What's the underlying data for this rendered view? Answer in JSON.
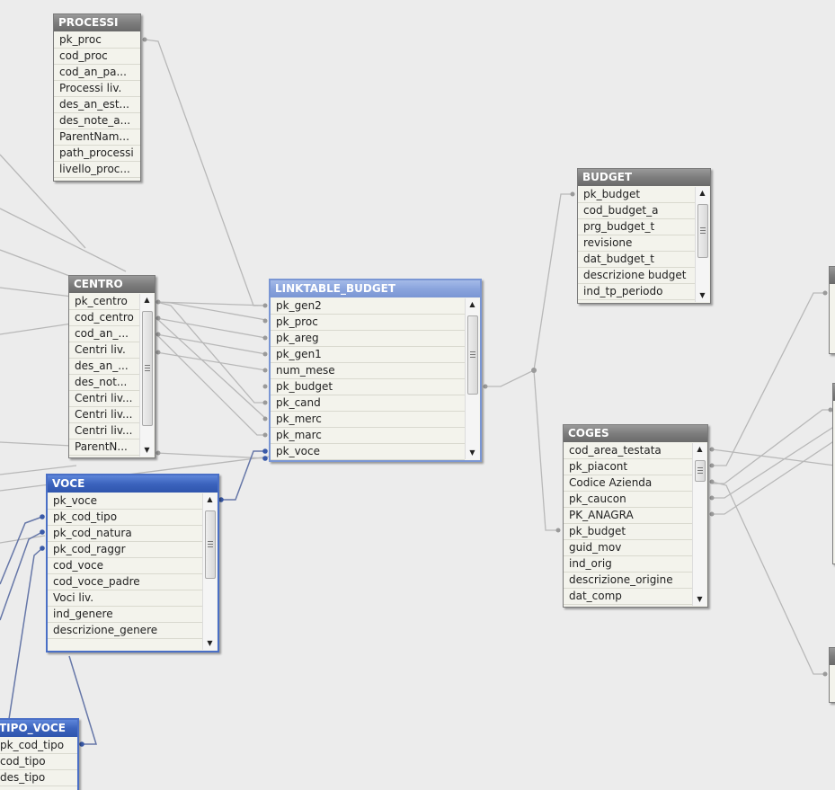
{
  "tables": {
    "processi": {
      "title": "PROCESSI",
      "fields": [
        "pk_proc",
        "cod_proc",
        "cod_an_pa...",
        "Processi liv.",
        "des_an_est...",
        "des_note_a...",
        "ParentNam...",
        "path_processi",
        "livello_proc..."
      ]
    },
    "centro": {
      "title": "CENTRO",
      "fields": [
        "pk_centro",
        "cod_centro",
        "cod_an_...",
        "Centri liv.",
        "des_an_...",
        "des_not...",
        "Centri liv...",
        "Centri liv...",
        "Centri liv...",
        "ParentN..."
      ]
    },
    "linktable": {
      "title": "LINKTABLE_BUDGET",
      "fields": [
        "pk_gen2",
        "pk_proc",
        "pk_areg",
        "pk_gen1",
        "num_mese",
        "pk_budget",
        "pk_cand",
        "pk_merc",
        "pk_marc",
        "pk_voce"
      ]
    },
    "budget": {
      "title": "BUDGET",
      "fields": [
        "pk_budget",
        "cod_budget_a",
        "prg_budget_t",
        "revisione",
        "dat_budget_t",
        "descrizione budget",
        "ind_tp_periodo"
      ]
    },
    "coges": {
      "title": "COGES",
      "fields": [
        "cod_area_testata",
        "pk_piacont",
        "Codice Azienda",
        "pk_caucon",
        "PK_ANAGRA",
        "pk_budget",
        "guid_mov",
        "ind_orig",
        "descrizione_origine",
        "dat_comp"
      ]
    },
    "voce": {
      "title": "VOCE",
      "fields": [
        "pk_voce",
        "pk_cod_tipo",
        "pk_cod_natura",
        "pk_cod_raggr",
        "cod_voce",
        "cod_voce_padre",
        "Voci liv.",
        "ind_genere",
        "descrizione_genere"
      ]
    },
    "tipo_voce": {
      "title": "TIPO_VOCE",
      "fields": [
        "pk_cod_tipo",
        "cod_tipo",
        "des_tipo"
      ]
    }
  },
  "colors": {
    "link_gray": "#b8b8b8",
    "link_blue": "#6677a8",
    "header_selected": "#3b63bd",
    "header_gray": "#7d7d7d"
  }
}
